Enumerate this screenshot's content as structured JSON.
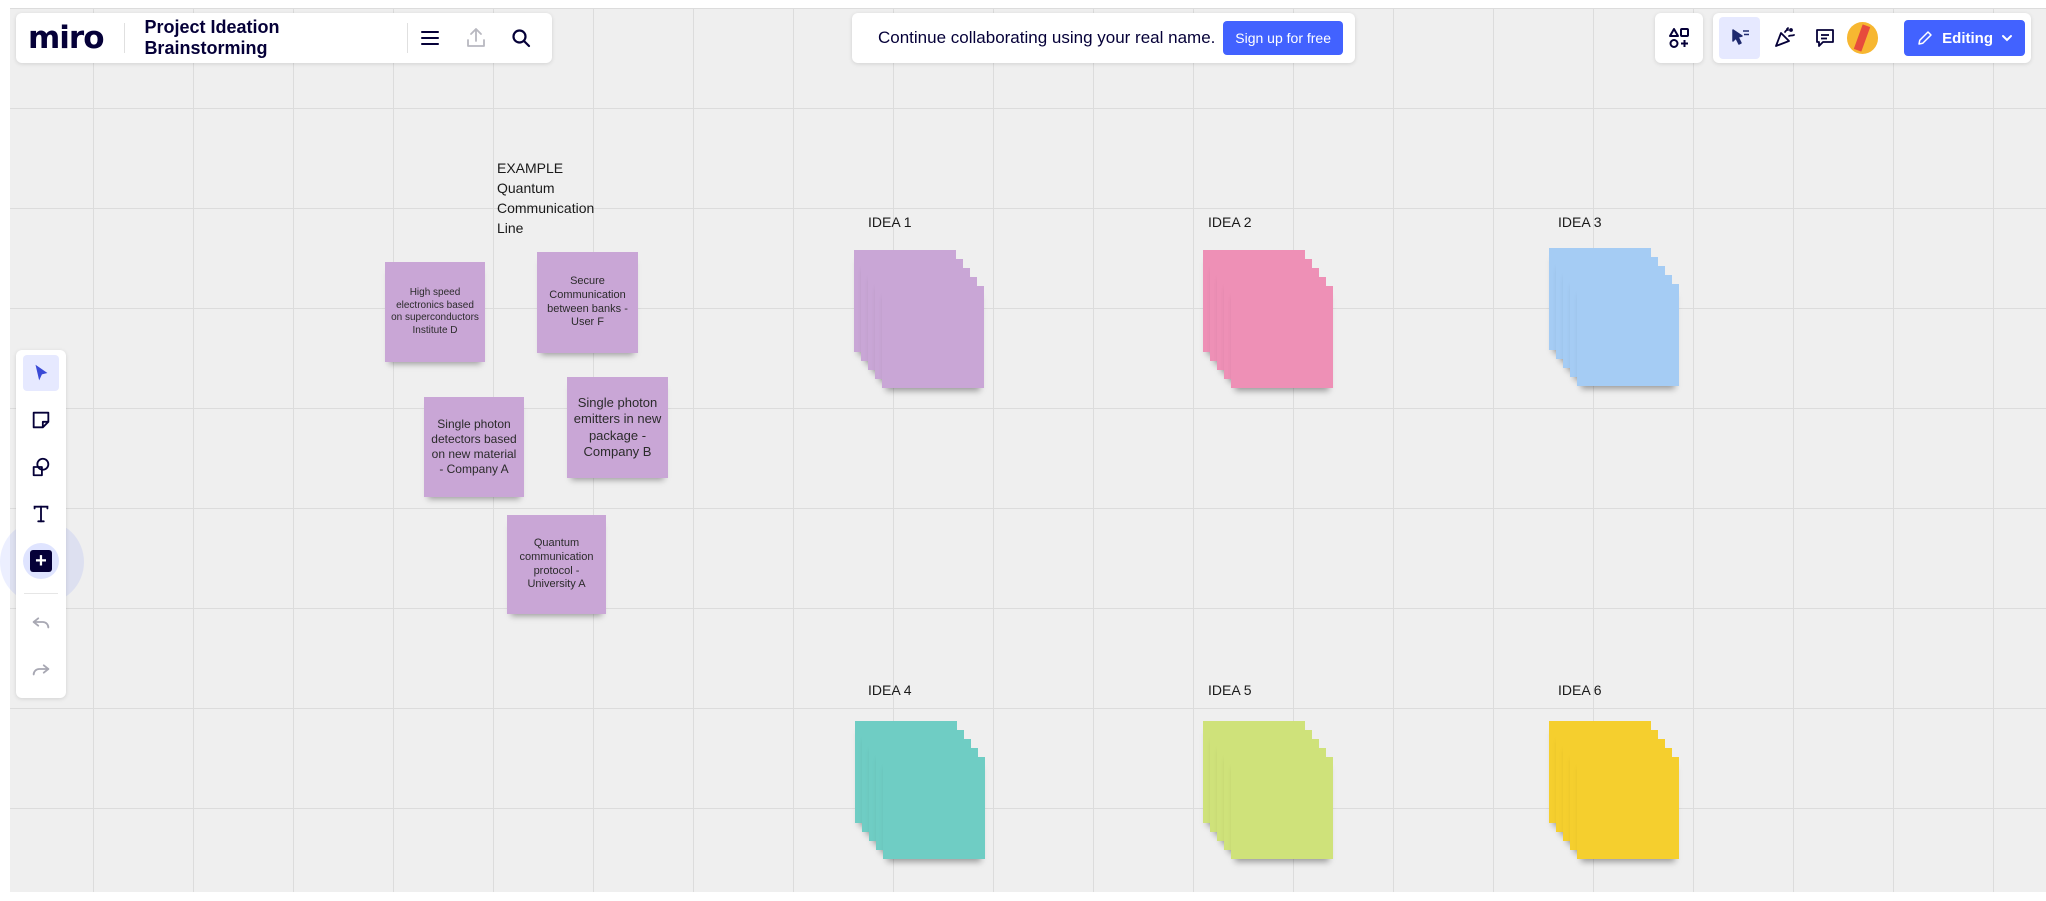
{
  "header": {
    "logo": "miro",
    "board_title": "Project Ideation Brainstorming"
  },
  "collab_banner": {
    "message": "Continue collaborating using your real name.",
    "signup_label": "Sign up for free"
  },
  "top_right": {
    "editing_label": "Editing"
  },
  "board": {
    "example_label": [
      "EXAMPLE",
      "Quantum",
      "Communication",
      "Line"
    ],
    "example_notes": [
      "High speed electronics based on superconductors Institute D",
      "Secure Communication between banks - User F",
      "Single photon detectors based on new material - Company A",
      "Single photon emitters in new package - Company B",
      "Quantum communication protocol - University A"
    ],
    "ideas": [
      {
        "label": "IDEA 1",
        "color": "#c9a6d6"
      },
      {
        "label": "IDEA 2",
        "color": "#ee90b6"
      },
      {
        "label": "IDEA 3",
        "color": "#a5ccf4"
      },
      {
        "label": "IDEA 4",
        "color": "#6fcdc4"
      },
      {
        "label": "IDEA 5",
        "color": "#cfe27a"
      },
      {
        "label": "IDEA 6",
        "color": "#f5cf2e"
      }
    ]
  },
  "icons": {
    "menu": "hamburger-icon",
    "export": "upload-icon",
    "search": "search-icon",
    "apps": "apps-icon",
    "reactions": "reactions-icon",
    "celebrate": "confetti-icon",
    "comments": "comment-icon",
    "edit": "pencil-icon",
    "select": "cursor-icon",
    "sticky": "sticky-note-icon",
    "shapes": "shapes-icon",
    "text": "text-icon",
    "add": "plus-icon",
    "undo": "undo-icon",
    "redo": "redo-icon"
  }
}
